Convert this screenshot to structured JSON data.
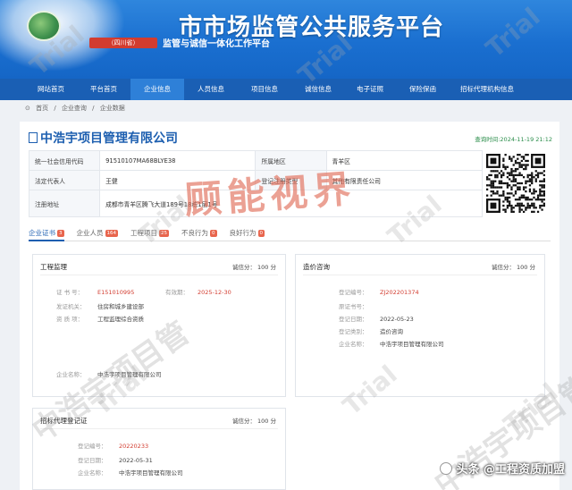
{
  "header": {
    "title": "市市场监管公共服务平台",
    "subtitle_tag": "（四川省）",
    "subtitle": "监管与诚信一体化工作平台"
  },
  "nav": {
    "items": [
      {
        "label": "网站首页",
        "active": false
      },
      {
        "label": "平台首页",
        "active": false
      },
      {
        "label": "企业信息",
        "active": true
      },
      {
        "label": "人员信息",
        "active": false
      },
      {
        "label": "项目信息",
        "active": false
      },
      {
        "label": "诚信信息",
        "active": false
      },
      {
        "label": "电子证照",
        "active": false
      },
      {
        "label": "保险保函",
        "active": false
      },
      {
        "label": "招标代理机构信息",
        "active": false
      }
    ]
  },
  "breadcrumb": [
    "首页",
    "/",
    "企业查询",
    "/",
    "企业数据"
  ],
  "company": {
    "name": "中浩宇项目管理有限公司",
    "query_time": "查询时间:2024-11-19 21:12",
    "info": {
      "credit_code_label": "统一社会信用代码",
      "credit_code": "91510107MA68BLYE38",
      "region_label": "所属地区",
      "region": "青羊区",
      "legal_rep_label": "法定代表人",
      "legal_rep": "王健",
      "reg_type_label": "登记注册类型",
      "reg_type": "其他有限责任公司",
      "address_label": "注册地址",
      "address": "成都市青羊区腾飞大道189号18栋1层1号"
    }
  },
  "tabs": [
    {
      "label": "企业证书",
      "badge": "3",
      "active": true
    },
    {
      "label": "企业人员",
      "badge": "164",
      "active": false
    },
    {
      "label": "工程项目",
      "badge": "25",
      "active": false
    },
    {
      "label": "不良行为",
      "badge": "0",
      "active": false
    },
    {
      "label": "良好行为",
      "badge": "0",
      "active": false
    }
  ],
  "cards": {
    "supervision": {
      "title": "工程监理",
      "score": "诚信分： 100 分",
      "cert_no_label": "证 书 号：",
      "cert_no": "E151010995",
      "valid_label": "有效期：",
      "valid": "2025-12-30",
      "issuer_label": "发证机关：",
      "issuer": "住房和城乡建设部",
      "qual_label": "资 质 项：",
      "qual": "工程监理综合资质",
      "company_label": "企业名称：",
      "company": "中浩宇项目管理有限公司"
    },
    "consulting": {
      "title": "造价咨询",
      "score": "诚信分： 100 分",
      "reg_no_label": "登记编号：",
      "reg_no": "ZJ202201374",
      "orig_no_label": "原证书号：",
      "orig_no": "",
      "reg_date_label": "登记日期：",
      "reg_date": "2022-05-23",
      "type_label": "登记类别：",
      "type": "造价咨询",
      "company_label": "企业名称：",
      "company": "中浩宇项目管理有限公司"
    },
    "bidding": {
      "title": "招标代理登记证",
      "score": "诚信分： 100 分",
      "reg_no_label": "登记编号：",
      "reg_no": "20220233",
      "reg_date_label": "登记日期：",
      "reg_date": "2022-05-31",
      "company_label": "企业名称：",
      "company": "中浩宇项目管理有限公司"
    }
  },
  "watermarks": {
    "trial": "Trial",
    "red": "顾能视界",
    "cn": "中浩宇项目管"
  },
  "brand": "头条 @工程资质加盟"
}
